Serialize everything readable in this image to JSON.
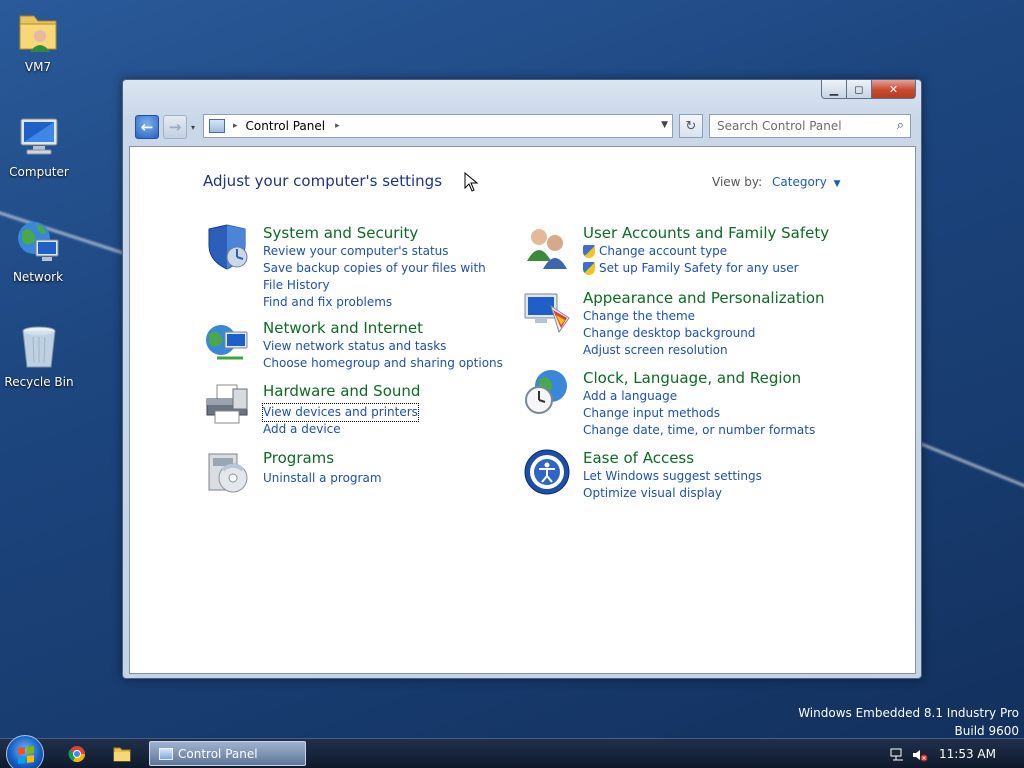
{
  "desktop": {
    "icons": [
      {
        "label": "VM7"
      },
      {
        "label": "Computer"
      },
      {
        "label": "Network"
      },
      {
        "label": "Recycle Bin"
      }
    ],
    "watermark": {
      "line1": "Windows Embedded 8.1 Industry Pro",
      "line2": "Build 9600"
    }
  },
  "window": {
    "address": {
      "crumb": "Control Panel"
    },
    "search": {
      "placeholder": "Search Control Panel"
    },
    "title": "Adjust your computer's settings",
    "view_by": {
      "label": "View by:",
      "value": "Category"
    },
    "categories": [
      {
        "name": "System and Security",
        "icon": "shield-icon",
        "links": [
          "Review your computer's status",
          "Save backup copies of your files with File History",
          "Find and fix problems"
        ]
      },
      {
        "name": "Network and Internet",
        "icon": "globe-network-icon",
        "links": [
          "View network status and tasks",
          "Choose homegroup and sharing options"
        ]
      },
      {
        "name": "Hardware and Sound",
        "icon": "printer-icon",
        "links": [
          "View devices and printers",
          "Add a device"
        ]
      },
      {
        "name": "Programs",
        "icon": "programs-disc-icon",
        "links": [
          "Uninstall a program"
        ]
      },
      {
        "name": "User Accounts and Family Safety",
        "icon": "users-icon",
        "links": [
          "Change account type",
          "Set up Family Safety for any user"
        ]
      },
      {
        "name": "Appearance and Personalization",
        "icon": "monitor-palette-icon",
        "links": [
          "Change the theme",
          "Change desktop background",
          "Adjust screen resolution"
        ]
      },
      {
        "name": "Clock, Language, and Region",
        "icon": "clock-globe-icon",
        "links": [
          "Add a language",
          "Change input methods",
          "Change date, time, or number formats"
        ]
      },
      {
        "name": "Ease of Access",
        "icon": "ease-of-access-icon",
        "links": [
          "Let Windows suggest settings",
          "Optimize visual display"
        ]
      }
    ]
  },
  "taskbar": {
    "active_task": "Control Panel",
    "clock": "11:53 AM"
  },
  "colors": {
    "link": "#1f4fb5",
    "category_heading": "#0b6b23",
    "title": "#1e3287"
  }
}
